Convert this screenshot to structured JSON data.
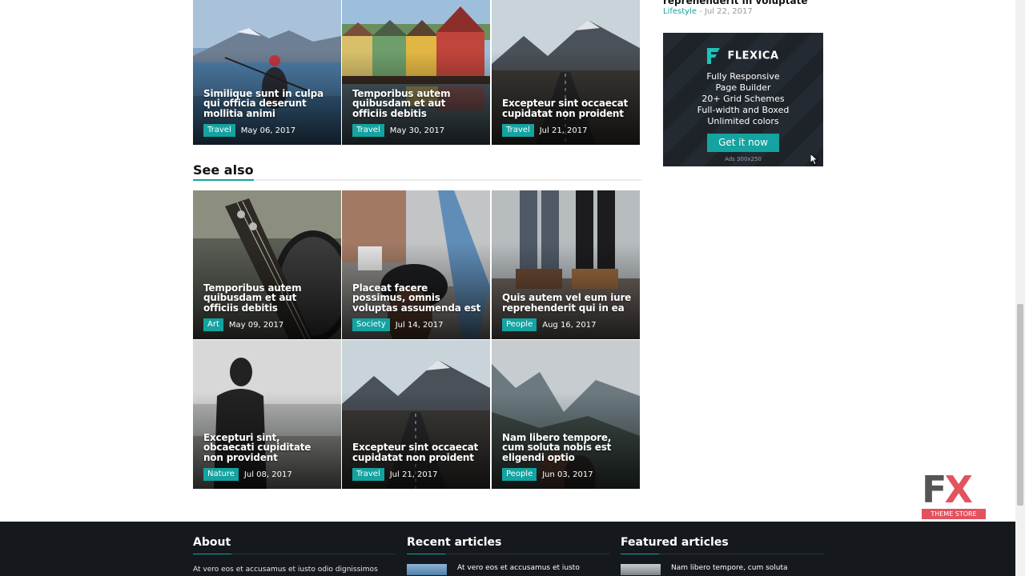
{
  "top_tiles": [
    {
      "title": "Similique sunt in culpa qui officia deserunt mollitia animi",
      "category": "Travel",
      "date": "May 06, 2017"
    },
    {
      "title": "Temporibus autem quibusdam et aut officiis debitis",
      "category": "Travel",
      "date": "May 30, 2017"
    },
    {
      "title": "Excepteur sint occaecat cupidatat non proident",
      "category": "Travel",
      "date": "Jul 21, 2017"
    }
  ],
  "see_also": {
    "heading": "See also",
    "tiles": [
      {
        "title": "Temporibus autem quibusdam et aut officiis debitis",
        "category": "Art",
        "date": "May 09, 2017"
      },
      {
        "title": "Placeat facere possimus, omnis voluptas assumenda est",
        "category": "Society",
        "date": "Jul 14, 2017"
      },
      {
        "title": "Quis autem vel eum iure reprehenderit qui in ea",
        "category": "People",
        "date": "Aug 16, 2017"
      },
      {
        "title": "Excepturi sint, obcaecati cupiditate non provident",
        "category": "Nature",
        "date": "Jul 08, 2017"
      },
      {
        "title": "Excepteur sint occaecat cupidatat non proident",
        "category": "Travel",
        "date": "Jul 21, 2017"
      },
      {
        "title": "Nam libero tempore, cum soluta nobis est eligendi optio",
        "category": "People",
        "date": "Jun 03, 2017"
      }
    ]
  },
  "sidebar": {
    "partial_title": "reprehenderit in voluptate",
    "category": "Lifestyle",
    "sep": " - ",
    "date": "Jul 22, 2017",
    "ad": {
      "brand": "FLEXICA",
      "lines": [
        "Fully Responsive",
        "Page Builder",
        "20+ Grid Schemes",
        "Full-width and Boxed",
        "Unlimited colors"
      ],
      "button": "Get it now",
      "size_note": "Ads 300x250"
    }
  },
  "badge": {
    "letters_f": "F",
    "letters_x": "X",
    "caption": "THEME STORE"
  },
  "footer": {
    "about": {
      "heading": "About",
      "text": "At vero eos et accusamus et iusto odio dignissimos"
    },
    "recent": {
      "heading": "Recent articles",
      "item": "At vero eos et accusamus et iusto"
    },
    "featured": {
      "heading": "Featured articles",
      "item": "Nam libero tempore, cum soluta"
    }
  },
  "colors": {
    "accent": "#14a3a0",
    "footer_bg": "#15191d",
    "badge_red": "#e2525f"
  }
}
